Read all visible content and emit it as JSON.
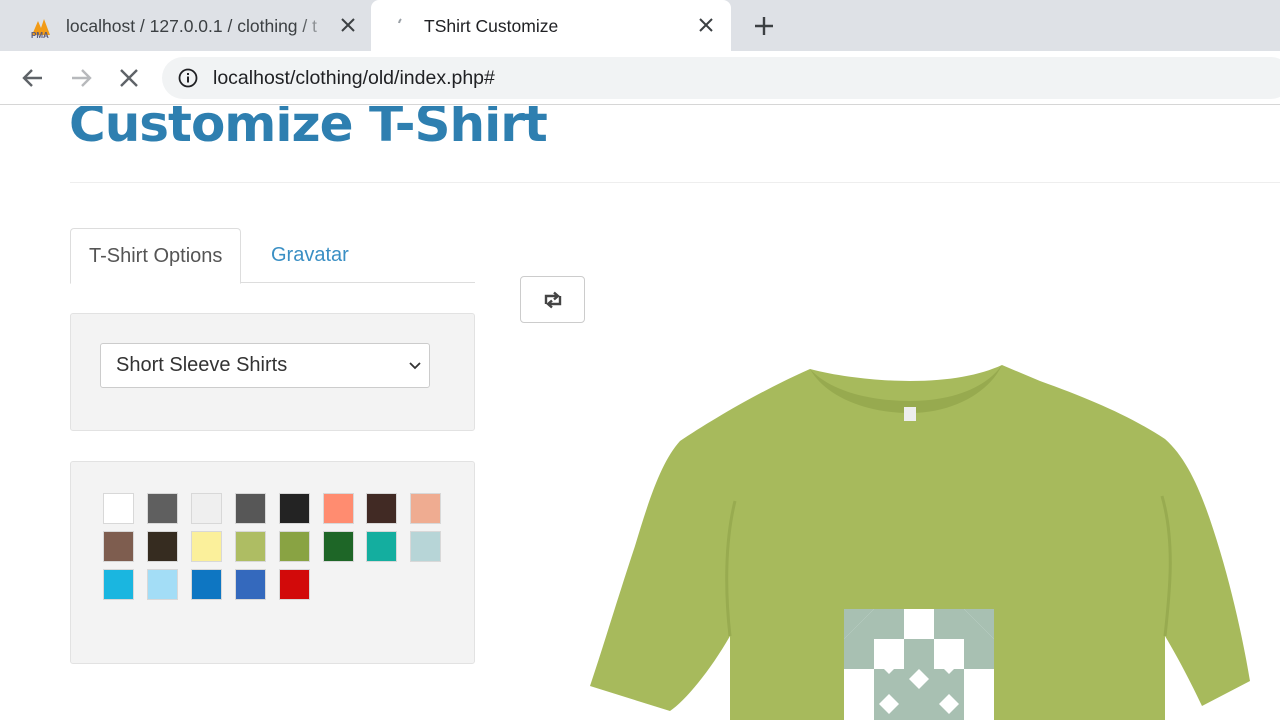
{
  "browser": {
    "tabs": [
      {
        "title": "localhost / 127.0.0.1 / clothing / t",
        "favicon": "phpmyadmin-icon",
        "active": false
      },
      {
        "title": "TShirt Customize",
        "favicon": "page-loading-icon",
        "active": true
      }
    ],
    "url": "localhost/clothing/old/index.php#"
  },
  "page": {
    "title": "Customize T-Shirt",
    "tabs": [
      {
        "label": "T-Shirt Options",
        "active": true
      },
      {
        "label": "Gravatar",
        "active": false
      }
    ],
    "shirt_type_select": {
      "selected": "Short Sleeve Shirts"
    },
    "swatches": [
      "#ffffff",
      "#5f5f5f",
      "#efefef",
      "#575757",
      "#232323",
      "#ff8c70",
      "#412a24",
      "#efac91",
      "#7e5d4f",
      "#362c20",
      "#fbf09b",
      "#aebd63",
      "#89a343",
      "#1e6627",
      "#14ae9f",
      "#b7d5d7",
      "#1ab6e0",
      "#a3ddf6",
      "#0e76c2",
      "#3469bd",
      "#d20a0a"
    ],
    "selected_shirt_color": "#a7ba5c",
    "design_color": "#a8c0b2"
  },
  "colors": {
    "title": "#2e7fb0",
    "link": "#3a8fc4"
  }
}
